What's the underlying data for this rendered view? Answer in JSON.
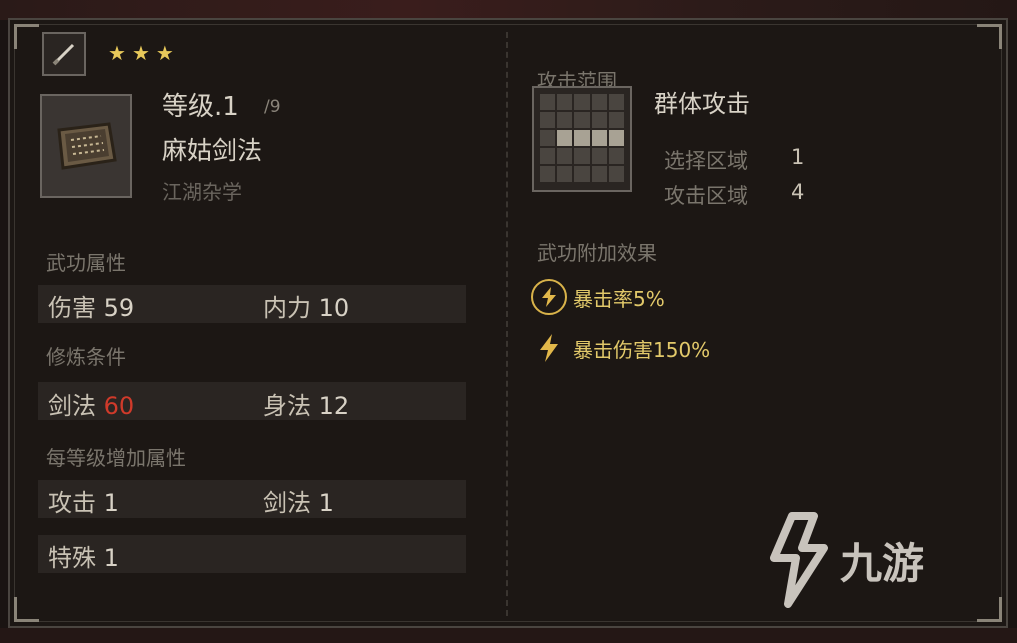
{
  "header": {
    "stars": [
      "★",
      "★",
      "★"
    ],
    "level_label": "等级.1",
    "level_max": "/9",
    "skill_name": "麻姑剑法",
    "skill_school": "江湖杂学"
  },
  "attributes": {
    "title": "武功属性",
    "damage_label": "伤害",
    "damage_value": "59",
    "inner_label": "内力",
    "inner_value": "10"
  },
  "requirements": {
    "title": "修炼条件",
    "sword_label": "剑法",
    "sword_value": "60",
    "body_label": "身法",
    "body_value": "12"
  },
  "per_level": {
    "title": "每等级增加属性",
    "attack_label": "攻击",
    "attack_value": "1",
    "sword_label": "剑法",
    "sword_value": "1",
    "special_label": "特殊",
    "special_value": "1"
  },
  "range": {
    "title": "攻击范围",
    "name": "群体攻击",
    "select_label": "选择区域",
    "select_value": "1",
    "attack_label": "攻击区域",
    "attack_value": "4"
  },
  "effects": {
    "title": "武功附加效果",
    "items": [
      "暴击率5%",
      "暴击伤害150%"
    ]
  },
  "watermark": {
    "text": "九游"
  },
  "colors": {
    "requirement_unmet": "#d03a2a",
    "star": "#e8c95a",
    "effect": "#e2c96a"
  }
}
